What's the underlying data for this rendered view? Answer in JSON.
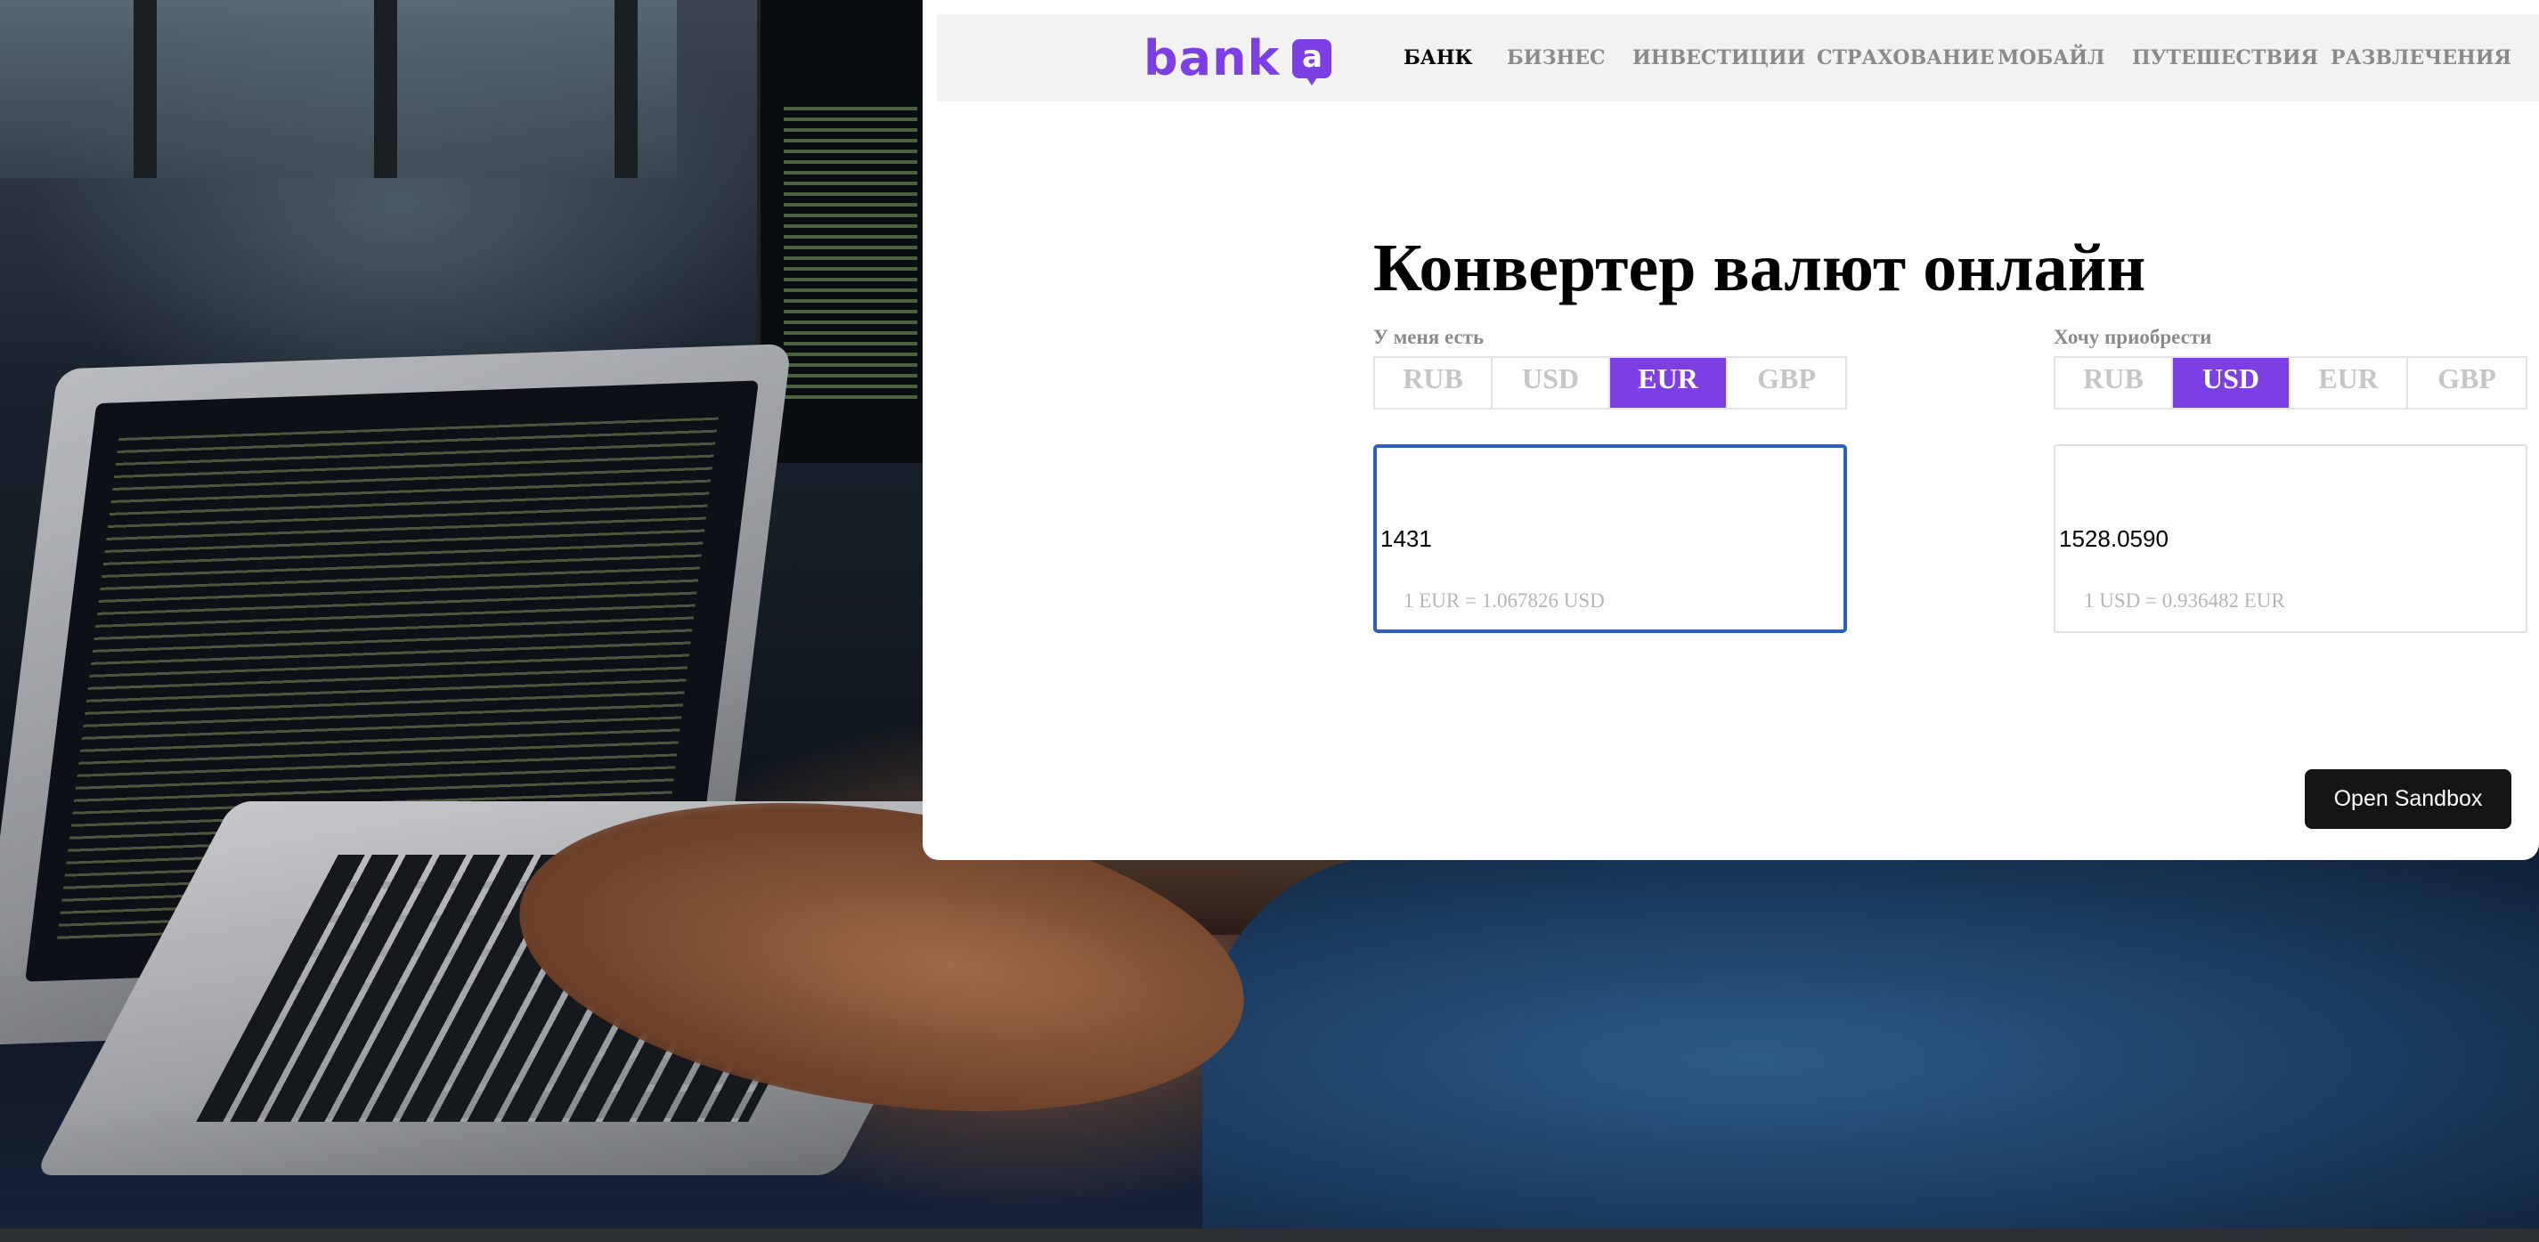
{
  "navbar": {
    "logo_text": "bank",
    "logo_badge_letter": "a",
    "items": [
      {
        "label": "БАНК",
        "active": true
      },
      {
        "label": "БИЗНЕС",
        "active": false
      },
      {
        "label": "ИНВЕСТИЦИИ",
        "active": false
      },
      {
        "label": "СТРАХОВАНИЕ",
        "active": false
      },
      {
        "label": "МОБАЙЛ",
        "active": false
      },
      {
        "label": "ПУТЕШЕСТВИЯ",
        "active": false
      },
      {
        "label": "РАЗВЛЕЧЕНИЯ",
        "active": false
      }
    ]
  },
  "converter": {
    "title": "Конвертер валют онлайн",
    "from": {
      "label": "У меня есть",
      "currencies": [
        "RUB",
        "USD",
        "EUR",
        "GBP"
      ],
      "selected": "EUR",
      "amount": "1431",
      "rate_note": "1 EUR = 1.067826 USD"
    },
    "to": {
      "label": "Хочу приобрести",
      "currencies": [
        "RUB",
        "USD",
        "EUR",
        "GBP"
      ],
      "selected": "USD",
      "amount": "1528.0590",
      "rate_note": "1 USD = 0.936482 EUR"
    }
  },
  "sandbox_button": {
    "label": "Open Sandbox"
  },
  "colors": {
    "brand": "#7b3fe4",
    "focus_border": "#2d5fbf",
    "nav_background": "#f2f2f2",
    "button_dark": "#151515"
  }
}
